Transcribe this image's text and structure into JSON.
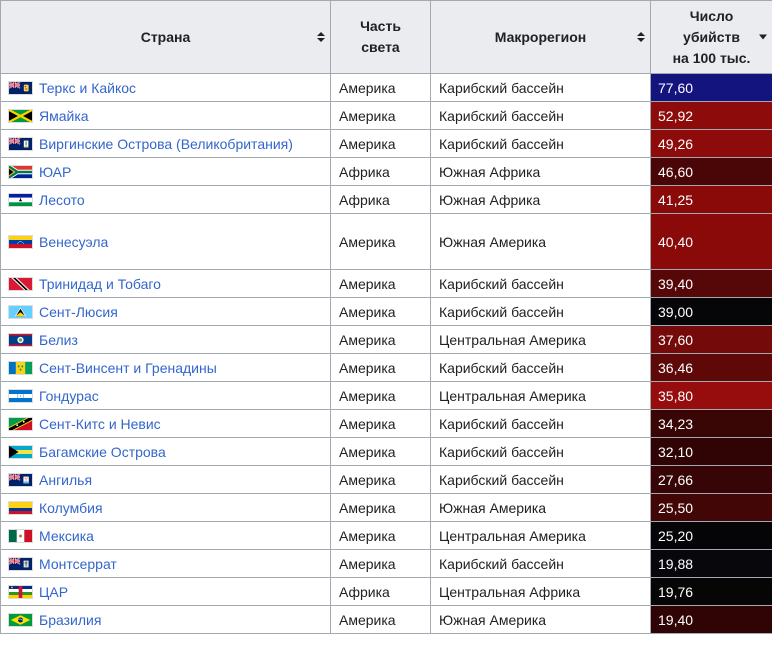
{
  "colors": {
    "header_bg": "#eaecf0",
    "table_border": "#a2a9b1",
    "link": "#3366cc",
    "row_bg": "#ffffff",
    "value_text": "#ffffff",
    "sort_icon": "#202122",
    "top_value_bg_blue": "#14147E"
  },
  "table": {
    "columns": [
      {
        "label": "Страна",
        "sort": "none"
      },
      {
        "label": "Часть света",
        "lines": [
          "Часть",
          "света"
        ],
        "sort": "none"
      },
      {
        "label": "Макрорегион",
        "sort": "none"
      },
      {
        "label": "Число убийств на 100 тыс.",
        "lines": [
          "Число",
          "убийств",
          "на 100 тыс."
        ],
        "sort": "desc"
      }
    ],
    "rows": [
      {
        "country": "Теркс и Кайкос",
        "flag": "turks-and-caicos",
        "continent": "Америка",
        "macroregion": "Карибский бассейн",
        "value": "77,60",
        "value_bg": "#14147E",
        "tall": false
      },
      {
        "country": "Ямайка",
        "flag": "jamaica",
        "continent": "Америка",
        "macroregion": "Карибский бассейн",
        "value": "52,92",
        "value_bg": "#8E0B0B",
        "tall": false
      },
      {
        "country": "Виргинские Острова (Великобритания)",
        "flag": "virgin-islands-uk",
        "continent": "Америка",
        "macroregion": "Карибский бассейн",
        "value": "49,26",
        "value_bg": "#8E0B0B",
        "tall": false
      },
      {
        "country": "ЮАР",
        "flag": "south-africa",
        "continent": "Африка",
        "macroregion": "Южная Африка",
        "value": "46,60",
        "value_bg": "#4A0606",
        "tall": false
      },
      {
        "country": "Лесото",
        "flag": "lesotho",
        "continent": "Африка",
        "macroregion": "Южная Африка",
        "value": "41,25",
        "value_bg": "#8A0A0A",
        "tall": false
      },
      {
        "country": "Венесуэла",
        "flag": "venezuela",
        "continent": "Америка",
        "macroregion": "Южная Америка",
        "value": "40,40",
        "value_bg": "#8A0A0A",
        "tall": true
      },
      {
        "country": "Тринидад и Тобаго",
        "flag": "trinidad-and-tobago",
        "continent": "Америка",
        "macroregion": "Карибский бассейн",
        "value": "39,40",
        "value_bg": "#560808",
        "tall": false
      },
      {
        "country": "Сент-Люсия",
        "flag": "saint-lucia",
        "continent": "Америка",
        "macroregion": "Карибский бассейн",
        "value": "39,00",
        "value_bg": "#060609",
        "tall": false
      },
      {
        "country": "Белиз",
        "flag": "belize",
        "continent": "Америка",
        "macroregion": "Центральная Америка",
        "value": "37,60",
        "value_bg": "#740A0A",
        "tall": false
      },
      {
        "country": "Сент-Винсент и Гренадины",
        "flag": "saint-vincent-and-grenadines",
        "continent": "Америка",
        "macroregion": "Карибский бассейн",
        "value": "36,46",
        "value_bg": "#5E0808",
        "tall": false
      },
      {
        "country": "Гондурас",
        "flag": "honduras",
        "continent": "Америка",
        "macroregion": "Центральная Америка",
        "value": "35,80",
        "value_bg": "#970C0C",
        "tall": false
      },
      {
        "country": "Сент-Китс и Невис",
        "flag": "saint-kitts-and-nevis",
        "continent": "Америка",
        "macroregion": "Карибский бассейн",
        "value": "34,23",
        "value_bg": "#3A0505",
        "tall": false
      },
      {
        "country": "Багамские Острова",
        "flag": "bahamas",
        "continent": "Америка",
        "macroregion": "Карибский бассейн",
        "value": "32,10",
        "value_bg": "#300404",
        "tall": false
      },
      {
        "country": "Ангилья",
        "flag": "anguilla",
        "continent": "Америка",
        "macroregion": "Карибский бассейн",
        "value": "27,66",
        "value_bg": "#370505",
        "tall": false
      },
      {
        "country": "Колумбия",
        "flag": "colombia",
        "continent": "Америка",
        "macroregion": "Южная Америка",
        "value": "25,50",
        "value_bg": "#420606",
        "tall": false
      },
      {
        "country": "Мексика",
        "flag": "mexico",
        "continent": "Америка",
        "macroregion": "Центральная Америка",
        "value": "25,20",
        "value_bg": "#050508",
        "tall": false
      },
      {
        "country": "Монтсеррат",
        "flag": "montserrat",
        "continent": "Америка",
        "macroregion": "Карибский бассейн",
        "value": "19,88",
        "value_bg": "#07070C",
        "tall": false
      },
      {
        "country": "ЦАР",
        "flag": "central-african-republic",
        "continent": "Африка",
        "macroregion": "Центральная Африка",
        "value": "19,76",
        "value_bg": "#060606",
        "tall": false
      },
      {
        "country": "Бразилия",
        "flag": "brazil",
        "continent": "Америка",
        "macroregion": "Южная Америка",
        "value": "19,40",
        "value_bg": "#300404",
        "tall": false
      }
    ]
  }
}
